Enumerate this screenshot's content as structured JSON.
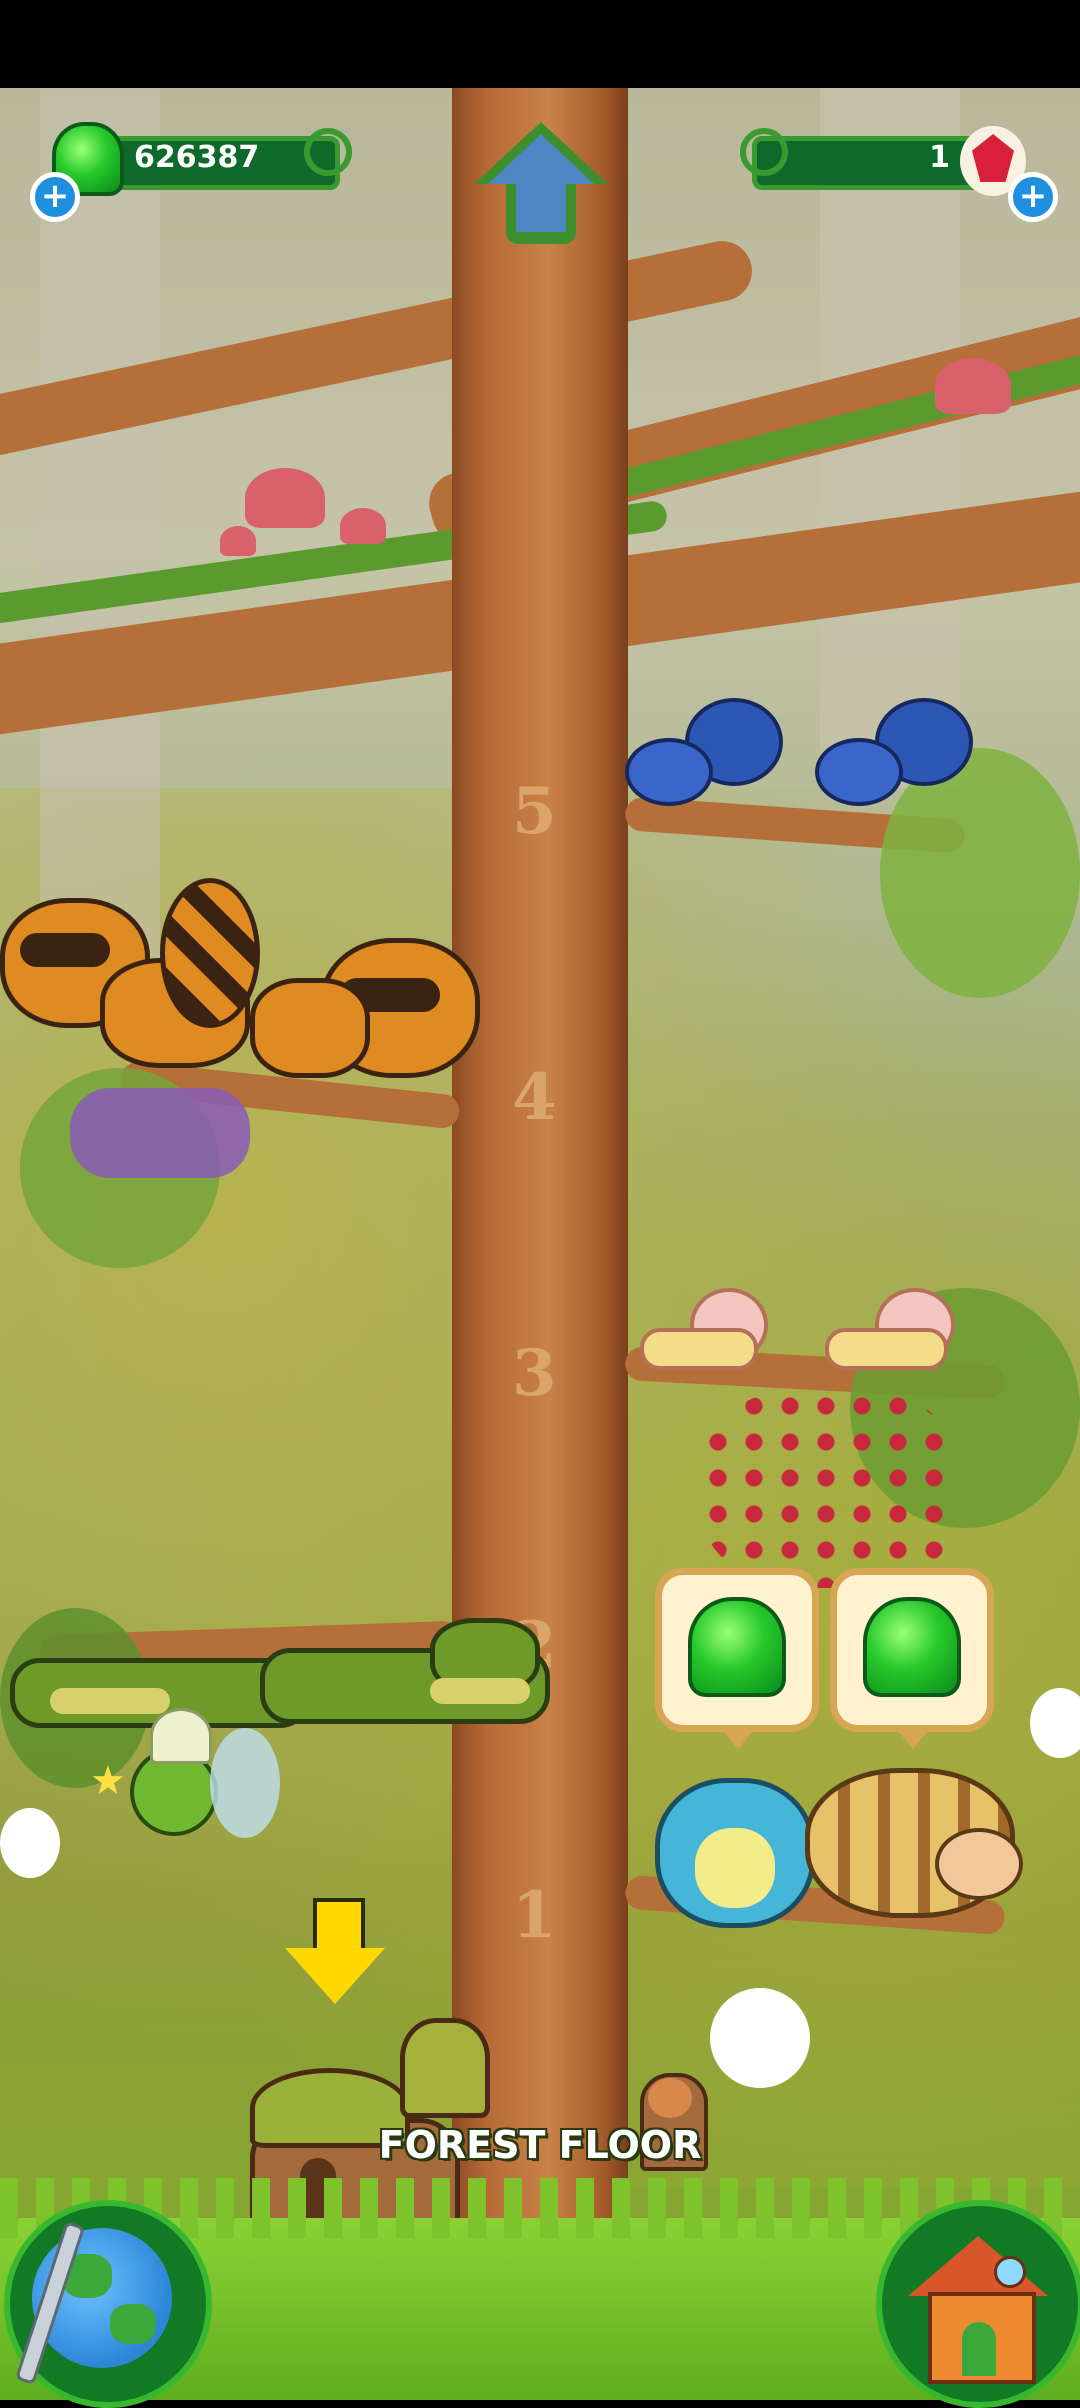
{
  "hud": {
    "jelly_count": "626387",
    "gem_count": "1"
  },
  "tree_levels": [
    "5",
    "4",
    "3",
    "2",
    "1"
  ],
  "location_label": "FOREST FLOOR",
  "colors": {
    "jelly_green": "#27c92b",
    "hud_bar": "#0e6a2a",
    "plus_blue": "#1f8fe0",
    "gem_red": "#d8203a",
    "arrow_yellow": "#ffd800"
  },
  "icons": {
    "home_up": "up-arrow-icon",
    "world": "globe-icon",
    "house": "house-icon",
    "add": "plus-icon",
    "down": "down-arrow-icon"
  }
}
